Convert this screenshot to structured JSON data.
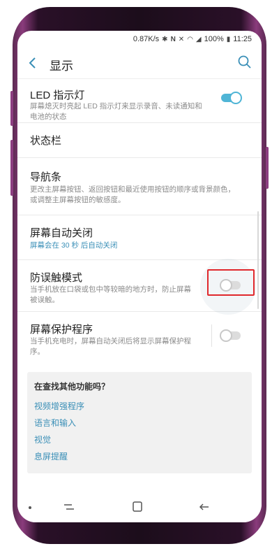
{
  "status": {
    "speed": "0.87K/s",
    "battery": "100%",
    "time": "11:25"
  },
  "appbar": {
    "title": "显示"
  },
  "settings": [
    {
      "title": "LED 指示灯",
      "subtitle": "屏幕熄灭时亮起 LED 指示灯来显示录音、未读通知和电池的状态",
      "toggle": "on"
    },
    {
      "title": "状态栏",
      "subtitle": ""
    },
    {
      "title": "导航条",
      "subtitle": "更改主屏幕按钮、返回按钮和最近使用按钮的顺序或背景颜色，或调整主屏幕按钮的敏感度。"
    },
    {
      "title": "屏幕自动关闭",
      "subtitle": "屏幕会在 30 秒 后自动关闭"
    },
    {
      "title": "防误触模式",
      "subtitle": "当手机放在口袋或包中等较暗的地方时，防止屏幕被误触。",
      "toggle": "off"
    },
    {
      "title": "屏幕保护程序",
      "subtitle": "当手机充电时，屏幕自动关闭后将显示屏幕保护程序。",
      "toggle": "off"
    }
  ],
  "card": {
    "heading": "在查找其他功能吗？",
    "links": [
      "视频增强程序",
      "语言和输入",
      "视觉",
      "息屏提醒"
    ]
  },
  "colors": {
    "accent": "#3a8fb7",
    "toggle_on": "#4fb5d6",
    "highlight": "#e0282c"
  }
}
